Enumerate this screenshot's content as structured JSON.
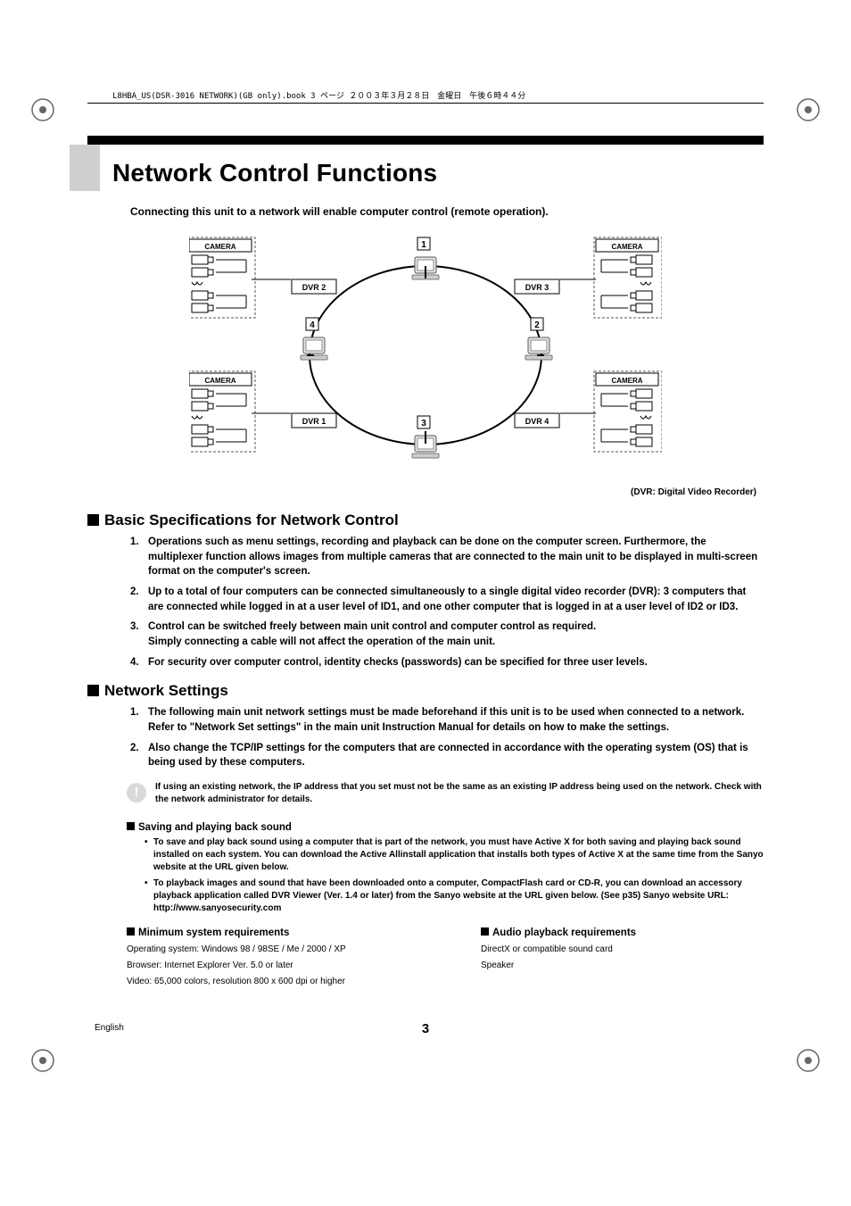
{
  "header_line": "L8HBA_US(DSR-3016 NETWORK)(GB only).book  3 ページ  ２００３年３月２８日　金曜日　午後６時４４分",
  "title": "Network Control Functions",
  "intro": "Connecting this unit to a network will enable computer control (remote operation).",
  "diagram": {
    "camera_label": "CAMERA",
    "dvr_labels": [
      "DVR 1",
      "DVR 2",
      "DVR 3",
      "DVR 4"
    ],
    "node_numbers": [
      "1",
      "2",
      "3",
      "4"
    ],
    "caption": "(DVR: Digital Video Recorder)"
  },
  "sections": {
    "basic": {
      "heading": "Basic Specifications for Network Control",
      "items": [
        "Operations such as menu settings, recording and playback can be done on the computer screen. Furthermore, the multiplexer function allows images from multiple cameras that are connected to the main unit to be displayed in multi-screen format on the computer's screen.",
        "Up to a total of four computers can be connected simultaneously to a single digital video recorder (DVR): 3 computers that are connected while logged in at a user level of ID1, and one other computer that is logged in at a user level of ID2 or ID3.",
        "Control can be switched freely between main unit control and computer control as required.\nSimply connecting a cable will not affect the operation of the main unit.",
        "For security over computer control, identity checks (passwords) can be specified for three user levels."
      ]
    },
    "network": {
      "heading": "Network Settings",
      "items": [
        "The following main unit network settings must be made beforehand if this unit is to be used when connected to a network. Refer to \"Network Set settings\" in the main unit Instruction Manual for details on how to make the settings.",
        "Also change the TCP/IP settings for the computers that are connected in accordance with the operating system (OS) that is being used by these computers."
      ],
      "note": "If using an existing network, the IP address that you set must not be the same as an existing IP address being used on the network. Check with the network administrator for details."
    },
    "sound": {
      "heading": "Saving and playing back sound",
      "bullets": [
        "To save and play back sound using a computer that is part of the network, you must have Active X for both saving and playing back sound installed on each system. You can download the Active Allinstall application that installs both types of Active X at the same time from the Sanyo website at the URL given below.",
        "To playback images and sound that have been downloaded onto a computer, CompactFlash card or CD-R, you can download an accessory playback application called DVR Viewer (Ver. 1.4 or later) from the Sanyo website at the URL given below. (See p35) Sanyo website URL: http://www.sanyosecurity.com"
      ]
    },
    "min_req": {
      "heading": "Minimum system requirements",
      "lines": [
        "Operating system: Windows 98 / 98SE / Me / 2000 / XP",
        "Browser: Internet Explorer Ver. 5.0 or later",
        "Video: 65,000 colors, resolution 800 x 600 dpi or higher"
      ]
    },
    "audio_req": {
      "heading": "Audio playback requirements",
      "lines": [
        "DirectX or compatible sound card",
        "Speaker"
      ]
    }
  },
  "footer": {
    "language": "English",
    "page": "3"
  }
}
